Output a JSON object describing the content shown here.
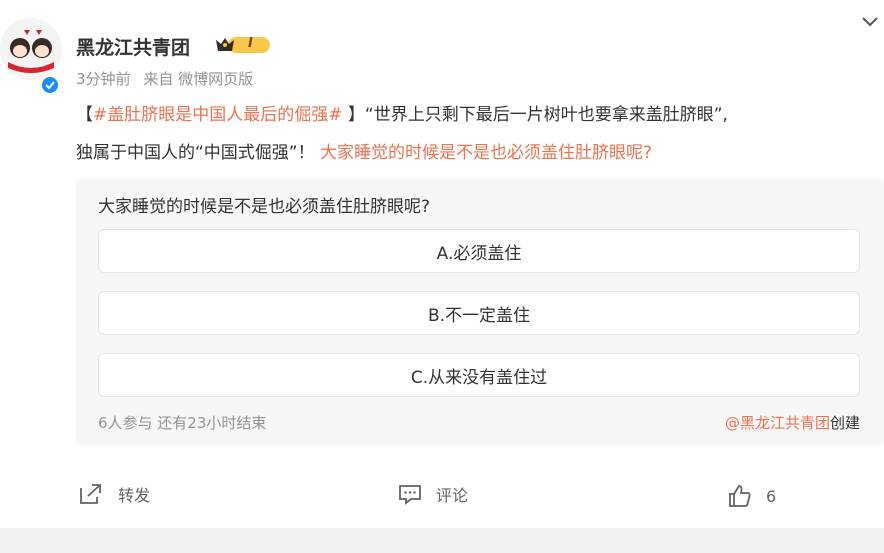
{
  "header": {
    "username": "黑龙江共青团",
    "level_badge": "I",
    "time_ago": "3分钟前",
    "source": "来自 微博网页版"
  },
  "post": {
    "bracket_open": "【",
    "hashtag": "#盖肚脐眼是中国人最后的倔强#",
    "bracket_close": " 】",
    "quote_text": "“世界上只剩下最后一片树叶也要拿来盖肚脐眼”,",
    "line2_text": "独属于中国人的“中国式倔强”！ ",
    "highlight_question": "大家睡觉的时候是不是也必须盖住肚脐眼呢?"
  },
  "poll": {
    "question": "大家睡觉的时候是不是也必须盖住肚脐眼呢?",
    "options": [
      {
        "label": "A.必须盖住"
      },
      {
        "label": "B.不一定盖住"
      },
      {
        "label": "C.从来没有盖住过"
      }
    ],
    "status": "6人参与 还有23小时结束",
    "creator": "@黑龙江共青团",
    "creator_suffix": "创建"
  },
  "actions": {
    "repost_label": "转发",
    "comment_label": "评论",
    "like_count": "6"
  },
  "colors": {
    "accent_orange": "#eb7350",
    "verified_blue": "#1b8ef5",
    "muted_text": "#939393",
    "poll_bg": "#f7f7f7"
  },
  "icons": [
    "chevron-down-icon",
    "verified-icon",
    "level-crown-icon",
    "repost-icon",
    "comment-icon",
    "like-icon"
  ]
}
